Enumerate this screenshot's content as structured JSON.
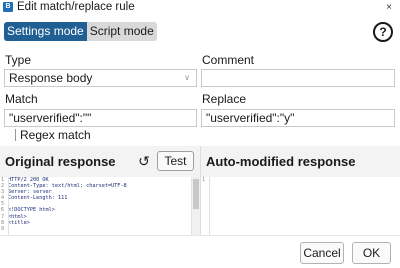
{
  "window": {
    "title": "Edit match/replace rule",
    "app_icon": "B",
    "close": "×"
  },
  "mode": {
    "settings_label": "Settings mode",
    "script_label": "Script mode",
    "active": "settings"
  },
  "help": {
    "label": "?"
  },
  "type": {
    "label": "Type",
    "value": "Response body"
  },
  "comment": {
    "label": "Comment",
    "value": ""
  },
  "match": {
    "label": "Match",
    "value": "\"userverified\":\"\""
  },
  "replace": {
    "label": "Replace",
    "value": "\"userverified\":\"y\""
  },
  "regex": {
    "label": "Regex match",
    "checked": false
  },
  "original": {
    "title": "Original response",
    "reset_icon": "↺",
    "test_label": "Test",
    "lines": [
      {
        "n": "1",
        "t": "HTTP/2 200 OK"
      },
      {
        "n": "2",
        "t": "Content-Type: text/html; charset=UTF-8"
      },
      {
        "n": "3",
        "t": "Server: server"
      },
      {
        "n": "4",
        "t": "Content-Length: 111"
      },
      {
        "n": "5",
        "t": ""
      },
      {
        "n": "6",
        "t": "<!DOCTYPE html>"
      },
      {
        "n": "7",
        "t": "<html>"
      },
      {
        "n": "8",
        "t": "    <title>"
      },
      {
        "n": "9",
        "t": ""
      }
    ]
  },
  "modified": {
    "title": "Auto-modified response",
    "lines": [
      {
        "n": "1",
        "t": ""
      }
    ]
  },
  "footer": {
    "cancel_label": "Cancel",
    "ok_label": "OK"
  },
  "colors": {
    "accent": "#1f5f94",
    "code_text": "#1c2d7a",
    "panel_head_bg": "#f3f3f3"
  },
  "icons": {
    "reset": "reset-icon",
    "help": "help-icon",
    "close": "close-icon",
    "chevron": "chevron-down-icon"
  }
}
